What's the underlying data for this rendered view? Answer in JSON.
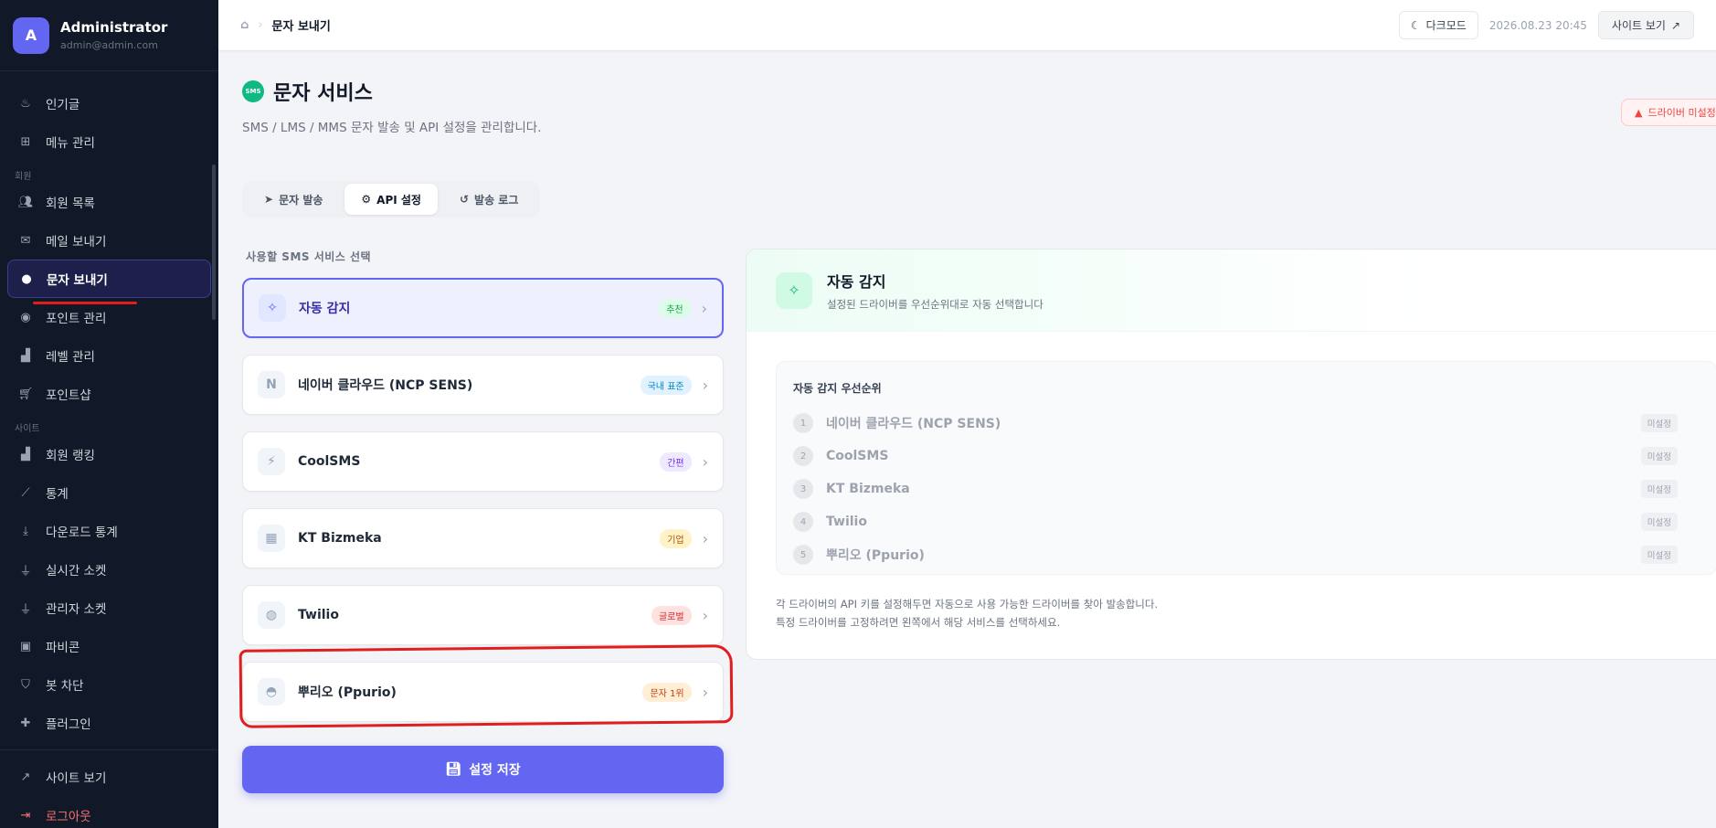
{
  "sidebar": {
    "avatar_letter": "A",
    "user_name": "Administrator",
    "user_email": "admin@admin.com",
    "items_top": [
      {
        "label": "인기글",
        "icon": "fire-icon"
      },
      {
        "label": "메뉴 관리",
        "icon": "sitemap-icon"
      }
    ],
    "section_members": "회원",
    "items_members": [
      {
        "label": "회원 목록",
        "icon": "users-icon"
      },
      {
        "label": "메일 보내기",
        "icon": "envelope-icon"
      },
      {
        "label": "문자 보내기",
        "icon": "chat-icon",
        "active": true
      },
      {
        "label": "포인트 관리",
        "icon": "coins-icon"
      },
      {
        "label": "레벨 관리",
        "icon": "levels-icon"
      },
      {
        "label": "포인트샵",
        "icon": "cart-icon"
      }
    ],
    "section_site": "사이트",
    "items_site": [
      {
        "label": "회원 랭킹",
        "icon": "ranking-icon"
      },
      {
        "label": "통계",
        "icon": "chart-line-icon"
      },
      {
        "label": "다운로드 통계",
        "icon": "download-icon"
      },
      {
        "label": "실시간 소켓",
        "icon": "plug-icon"
      },
      {
        "label": "관리자 소켓",
        "icon": "plug-icon"
      },
      {
        "label": "파비콘",
        "icon": "favicon-icon"
      },
      {
        "label": "봇 차단",
        "icon": "shield-icon"
      },
      {
        "label": "플러그인",
        "icon": "puzzle-icon"
      }
    ],
    "site_view": "사이트 보기",
    "logout": "로그아웃"
  },
  "topbar": {
    "breadcrumb_current": "문자 보내기",
    "dark_mode": "다크모드",
    "datetime": "2026.08.23 20:45",
    "site_view": "사이트 보기"
  },
  "header": {
    "badge": "SMS",
    "title": "문자 서비스",
    "subtitle": "SMS / LMS / MMS 문자 발송 및 API 설정을 관리합니다.",
    "warning": "드라이버 미설정"
  },
  "tabs": [
    {
      "label": "문자 발송",
      "icon": "paper-plane-icon"
    },
    {
      "label": "API 설정",
      "icon": "gear-icon",
      "active": true
    },
    {
      "label": "발송 로그",
      "icon": "history-icon"
    }
  ],
  "services": {
    "label": "사용할 SMS 서비스 선택",
    "items": [
      {
        "name": "자동 감지",
        "icon": "magic-wand-icon",
        "glyph": "✧",
        "tag": "추천",
        "tag_color": "#16a34a",
        "tag_bg": "#dcfce7",
        "selected": true
      },
      {
        "name": "네이버 클라우드 (NCP SENS)",
        "icon": "naver-icon",
        "glyph": "N",
        "tag": "국내 표준",
        "tag_color": "#0284c7",
        "tag_bg": "#e0f2fe"
      },
      {
        "name": "CoolSMS",
        "icon": "bolt-icon",
        "glyph": "⚡",
        "tag": "간편",
        "tag_color": "#7c3aed",
        "tag_bg": "#ede9fe"
      },
      {
        "name": "KT Bizmeka",
        "icon": "building-icon",
        "glyph": "▦",
        "tag": "기업",
        "tag_color": "#b45309",
        "tag_bg": "#fef3c7"
      },
      {
        "name": "Twilio",
        "icon": "globe-icon",
        "glyph": "◍",
        "tag": "글로벌",
        "tag_color": "#dc2626",
        "tag_bg": "#fee2e2"
      },
      {
        "name": "뿌리오 (Ppurio)",
        "icon": "message-icon",
        "glyph": "◓",
        "tag": "문자 1위",
        "tag_color": "#c2410c",
        "tag_bg": "#ffedd5"
      }
    ]
  },
  "save_button": "설정 저장",
  "panel": {
    "title": "자동 감지",
    "subtitle": "설정된 드라이버를 우선순위대로 자동 선택합니다",
    "priority_title": "자동 감지 우선순위",
    "priority": [
      {
        "num": "1",
        "name": "네이버 클라우드 (NCP SENS)",
        "status": "미설정"
      },
      {
        "num": "2",
        "name": "CoolSMS",
        "status": "미설정"
      },
      {
        "num": "3",
        "name": "KT Bizmeka",
        "status": "미설정"
      },
      {
        "num": "4",
        "name": "Twilio",
        "status": "미설정"
      },
      {
        "num": "5",
        "name": "뿌리오 (Ppurio)",
        "status": "미설정"
      }
    ],
    "note_1": "각 드라이버의 API 키를 설정해두면 자동으로 사용 가능한 드라이버를 찾아 발송합니다.",
    "note_2": "특정 드라이버를 고정하려면 왼쪽에서 해당 서비스를 선택하세요."
  }
}
